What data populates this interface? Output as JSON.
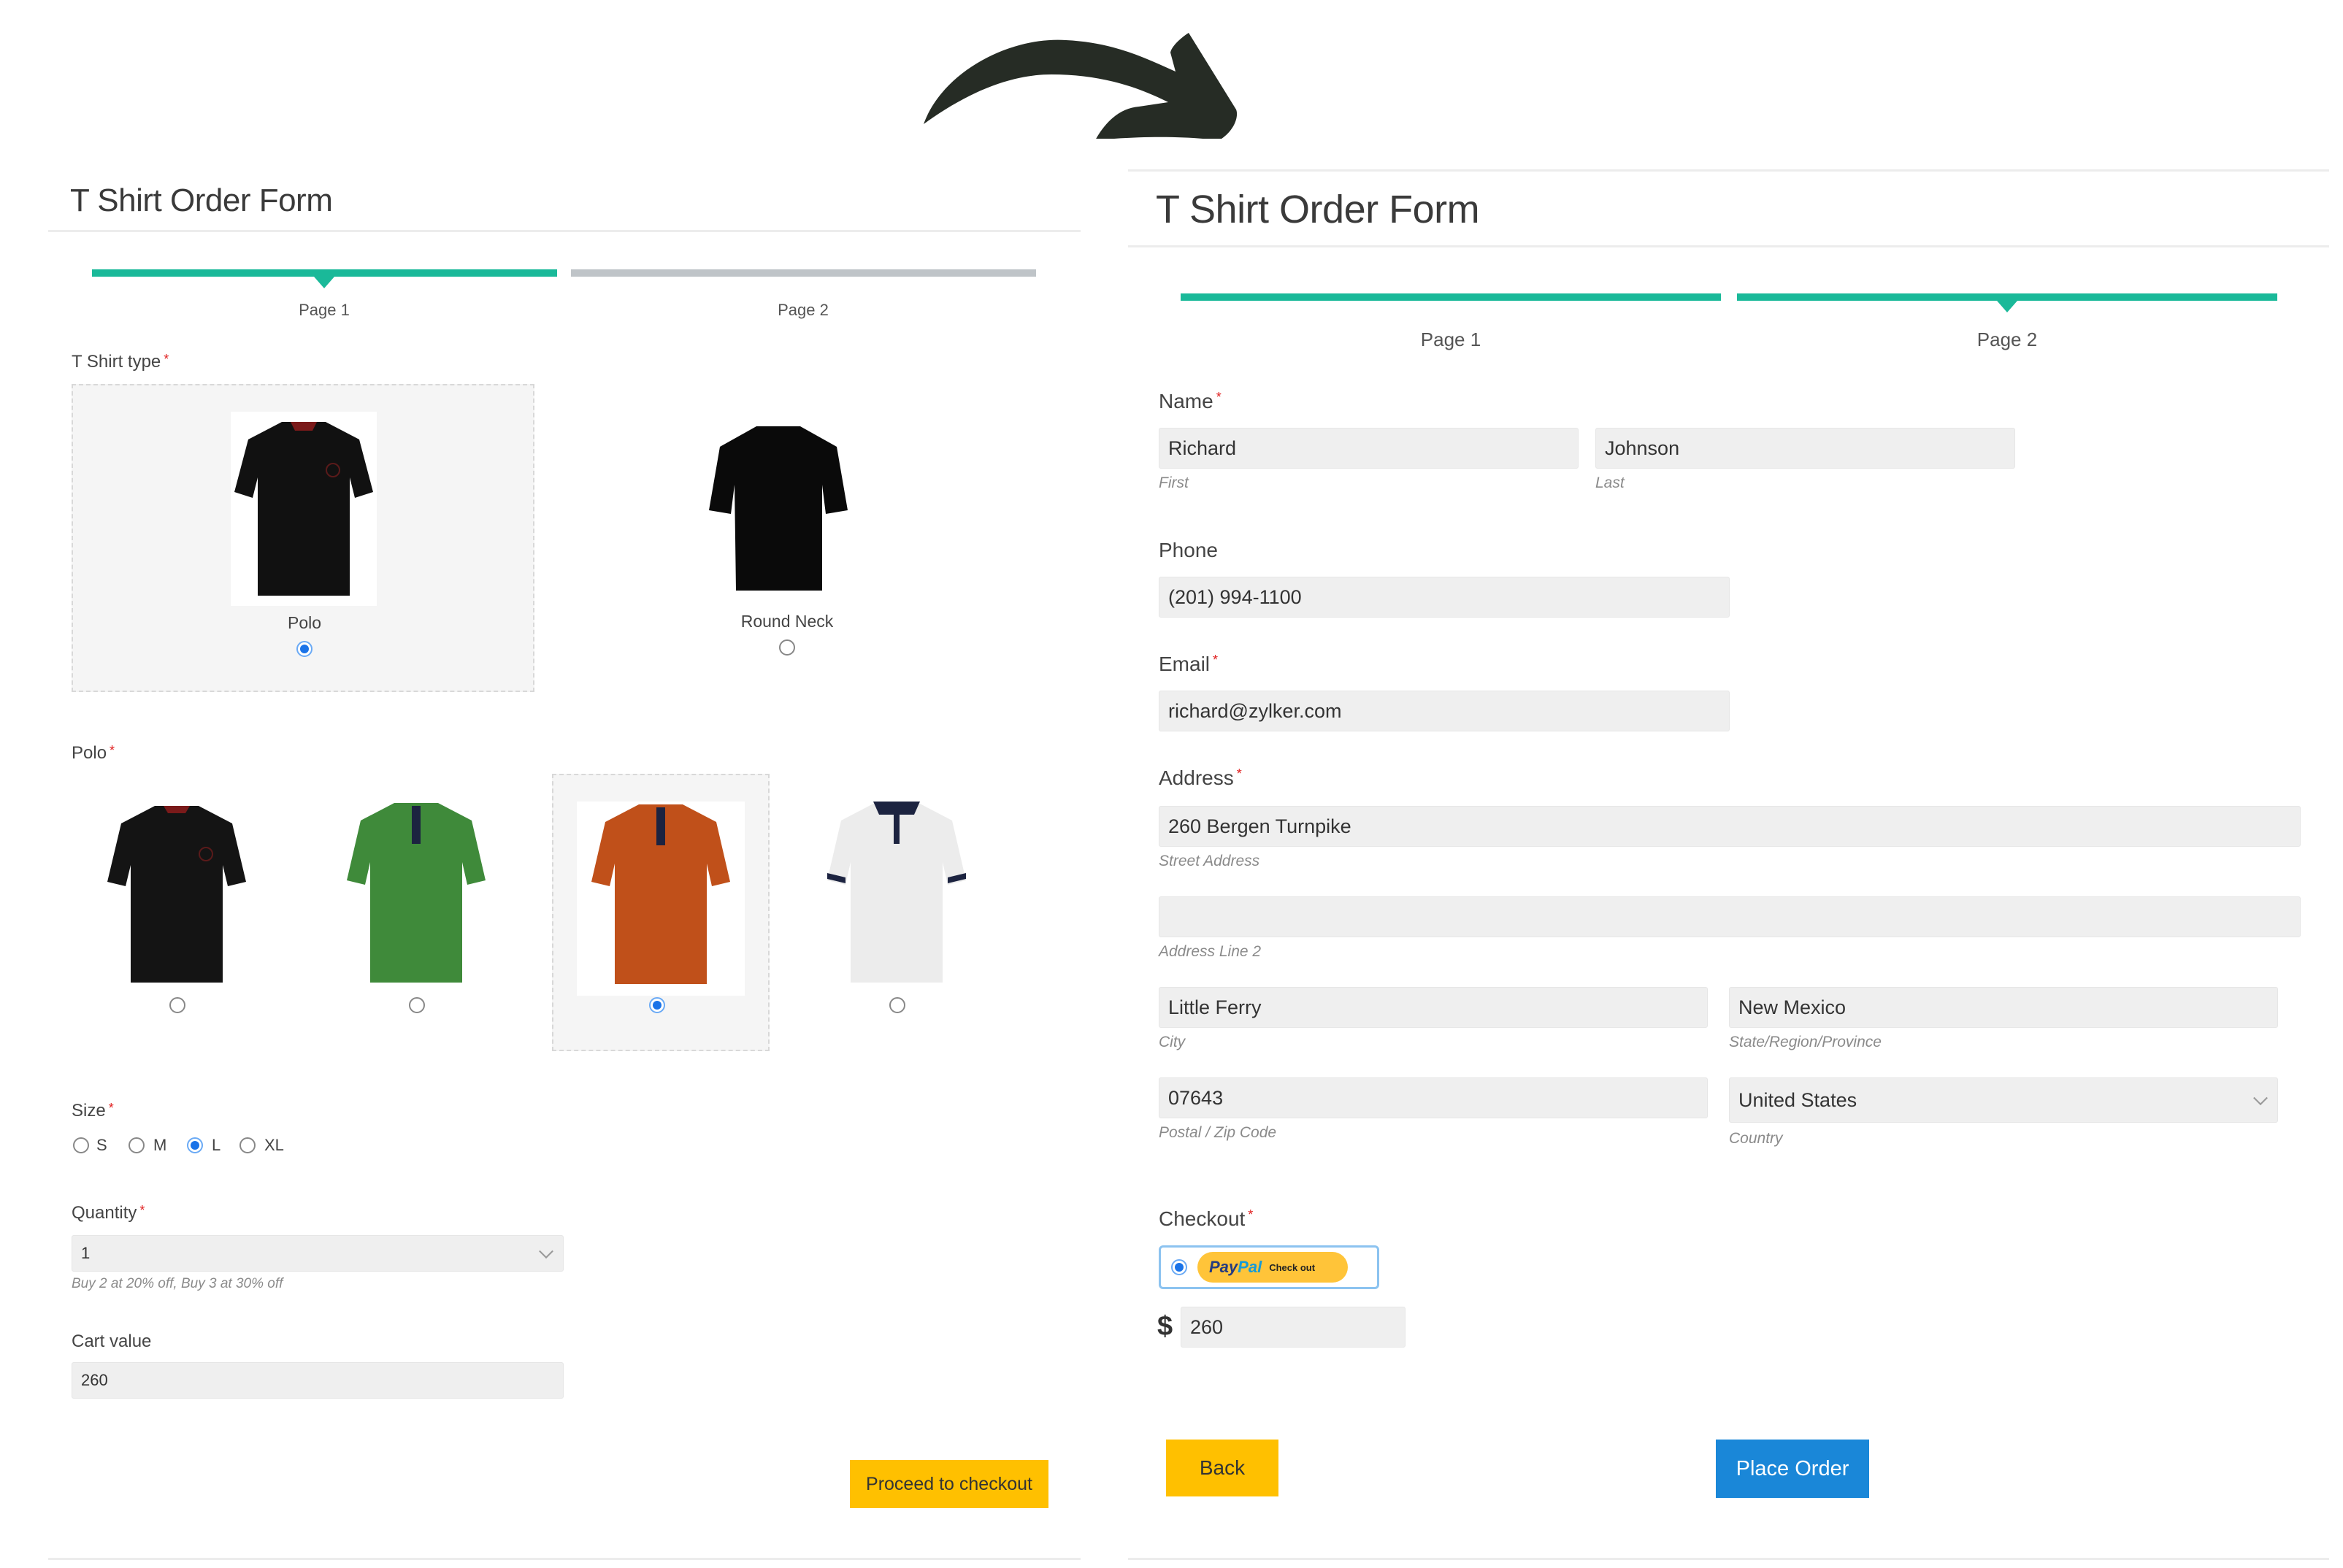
{
  "arrow": {
    "icon": "curved-arrow-right-icon",
    "color": "#262c25"
  },
  "left_form": {
    "title": "T Shirt Order Form",
    "steps": [
      {
        "label": "Page 1",
        "state": "current"
      },
      {
        "label": "Page 2",
        "state": "upcoming"
      }
    ],
    "tshirt_type": {
      "label": "T Shirt type",
      "required_mark": "*",
      "options": [
        {
          "caption": "Polo",
          "image": "black-polo-shirt",
          "selected": true
        },
        {
          "caption": "Round Neck",
          "image": "black-round-neck-shirt",
          "selected": false
        }
      ]
    },
    "polo": {
      "label": "Polo",
      "required_mark": "*",
      "options": [
        {
          "color_name": "black",
          "swatch": "#141414",
          "selected": false
        },
        {
          "color_name": "green",
          "swatch": "#3f8a3a",
          "selected": false
        },
        {
          "color_name": "orange",
          "swatch": "#c0501a",
          "selected": true
        },
        {
          "color_name": "white",
          "swatch": "#ececec",
          "selected": false
        }
      ]
    },
    "size": {
      "label": "Size",
      "required_mark": "*",
      "options": [
        {
          "label": "S",
          "selected": false
        },
        {
          "label": "M",
          "selected": false
        },
        {
          "label": "L",
          "selected": true
        },
        {
          "label": "XL",
          "selected": false
        }
      ]
    },
    "quantity": {
      "label": "Quantity",
      "required_mark": "*",
      "value": "1",
      "hint": "Buy 2 at 20% off, Buy 3 at 30% off"
    },
    "cart_value": {
      "label": "Cart value",
      "value": "260"
    },
    "proceed_button": "Proceed to checkout"
  },
  "right_form": {
    "title": "T Shirt Order Form",
    "steps": [
      {
        "label": "Page 1",
        "state": "complete"
      },
      {
        "label": "Page 2",
        "state": "current"
      }
    ],
    "name": {
      "label": "Name",
      "required_mark": "*",
      "first": {
        "value": "Richard",
        "sublabel": "First"
      },
      "last": {
        "value": "Johnson",
        "sublabel": "Last"
      }
    },
    "phone": {
      "label": "Phone",
      "value": "(201) 994-1100"
    },
    "email": {
      "label": "Email",
      "required_mark": "*",
      "value": "richard@zylker.com"
    },
    "address": {
      "label": "Address",
      "required_mark": "*",
      "street": {
        "value": "260 Bergen Turnpike",
        "sublabel": "Street Address"
      },
      "line2": {
        "value": "",
        "sublabel": "Address Line 2"
      },
      "city": {
        "value": "Little Ferry",
        "sublabel": "City"
      },
      "state": {
        "value": "New Mexico",
        "sublabel": "State/Region/Province"
      },
      "zip": {
        "value": "07643",
        "sublabel": "Postal / Zip Code"
      },
      "country": {
        "value": "United States",
        "sublabel": "Country"
      }
    },
    "checkout": {
      "label": "Checkout",
      "required_mark": "*",
      "paypal_pay": "Pay",
      "paypal_pal": "Pal",
      "paypal_text": "Check out",
      "selected": true
    },
    "amount": {
      "currency_symbol": "$",
      "value": "260"
    },
    "back_button": "Back",
    "place_order_button": "Place Order"
  },
  "colors": {
    "progress_active": "#1ab999",
    "progress_inactive": "#bfc4c8",
    "button_yellow": "#ffc000",
    "button_blue": "#1a87d8",
    "radio_selected": "#1a73e8",
    "required": "#e02020"
  }
}
